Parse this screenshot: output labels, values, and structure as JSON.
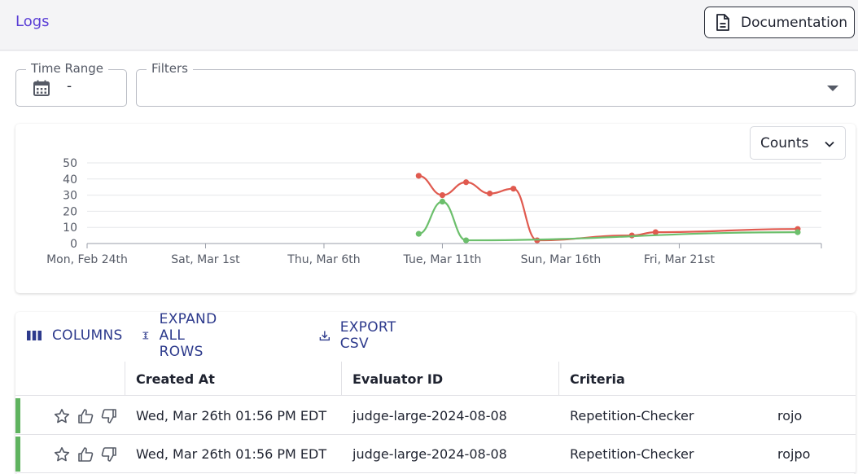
{
  "header": {
    "title": "Logs",
    "doc_button": "Documentation",
    "doc_icon": "document-icon"
  },
  "filters": {
    "time_range_label": "Time Range",
    "time_range_value": "-",
    "filters_label": "Filters"
  },
  "chart": {
    "metric_select": "Counts"
  },
  "chart_data": {
    "type": "line",
    "title": "",
    "xlabel": "",
    "ylabel": "",
    "ylim": [
      0,
      50
    ],
    "yticks": [
      0,
      10,
      20,
      30,
      40,
      50
    ],
    "xlim": [
      "2025-02-24",
      "2025-03-27"
    ],
    "xticks": [
      {
        "date": "2025-02-24",
        "label": "Mon, Feb 24th"
      },
      {
        "date": "2025-03-01",
        "label": "Sat, Mar 1st"
      },
      {
        "date": "2025-03-06",
        "label": "Thu, Mar 6th"
      },
      {
        "date": "2025-03-11",
        "label": "Tue, Mar 11th"
      },
      {
        "date": "2025-03-16",
        "label": "Sun, Mar 16th"
      },
      {
        "date": "2025-03-21",
        "label": "Fri, Mar 21st"
      }
    ],
    "grid": true,
    "legend": "none",
    "series": [
      {
        "color": "#e05a4f",
        "points": [
          {
            "x": "2025-03-10",
            "y": 42
          },
          {
            "x": "2025-03-11",
            "y": 30
          },
          {
            "x": "2025-03-12",
            "y": 38
          },
          {
            "x": "2025-03-13",
            "y": 31
          },
          {
            "x": "2025-03-14",
            "y": 34
          },
          {
            "x": "2025-03-15",
            "y": 2
          },
          {
            "x": "2025-03-19",
            "y": 5
          },
          {
            "x": "2025-03-20",
            "y": 7
          },
          {
            "x": "2025-03-26",
            "y": 9
          }
        ]
      },
      {
        "color": "#6cbf6c",
        "points": [
          {
            "x": "2025-03-10",
            "y": 6
          },
          {
            "x": "2025-03-11",
            "y": 26
          },
          {
            "x": "2025-03-12",
            "y": 2
          },
          {
            "x": "2025-03-26",
            "y": 7
          }
        ]
      }
    ]
  },
  "table": {
    "toolbar": {
      "columns": "COLUMNS",
      "expand": "EXPAND ALL ROWS",
      "export": "EXPORT CSV"
    },
    "headers": [
      "Created At",
      "Evaluator ID",
      "Criteria"
    ],
    "rows": [
      {
        "created_at": "Wed, Mar 26th 01:56 PM EDT",
        "evaluator_id": "judge-large-2024-08-08",
        "criteria": "Repetition-Checker",
        "extra": "rojo",
        "status_color": "#5fb35f"
      },
      {
        "created_at": "Wed, Mar 26th 01:56 PM EDT",
        "evaluator_id": "judge-large-2024-08-08",
        "criteria": "Repetition-Checker",
        "extra": "rojpo",
        "status_color": "#5fb35f"
      }
    ]
  }
}
